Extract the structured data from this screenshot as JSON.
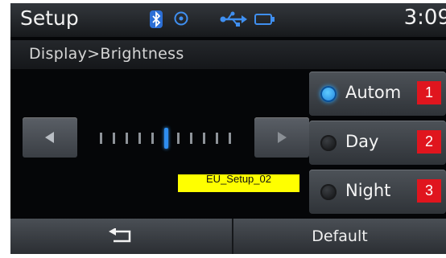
{
  "statusbar": {
    "title": "Setup",
    "clock": "3:09",
    "icons": [
      "bluetooth-icon",
      "disc-icon",
      "usb-icon",
      "battery-icon"
    ]
  },
  "breadcrumb": {
    "text": "Display>Brightness"
  },
  "brightness": {
    "ticks": 11,
    "level_index": 5
  },
  "options": [
    {
      "label": "Autom",
      "number": "1",
      "selected": true
    },
    {
      "label": "Day",
      "number": "2",
      "selected": false
    },
    {
      "label": "Night",
      "number": "3",
      "selected": false
    }
  ],
  "overlay_label": "EU_Setup_02",
  "bottom": {
    "back_icon": "back-icon",
    "default_label": "Default"
  },
  "colors": {
    "accent": "#2e8ef0",
    "badge": "#e0151e",
    "overlay": "#ffff00"
  }
}
